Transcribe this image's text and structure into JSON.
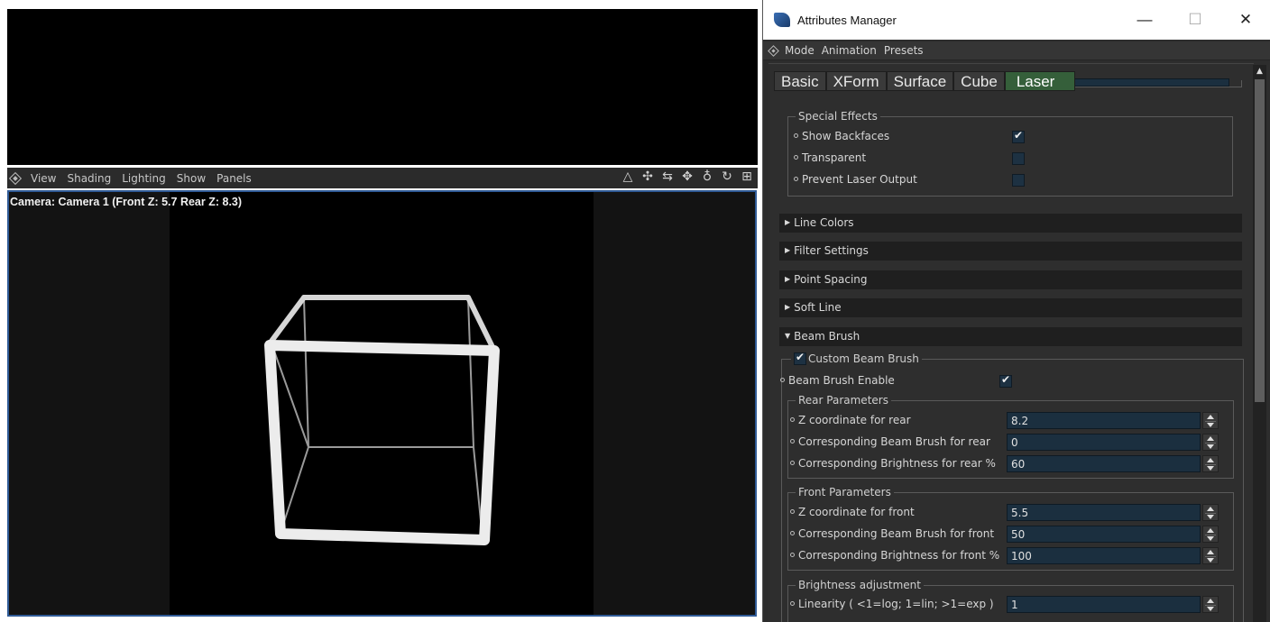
{
  "viewport": {
    "menu": [
      "View",
      "Shading",
      "Lighting",
      "Show",
      "Panels"
    ],
    "camera_label": "Camera: Camera 1 (Front Z: 5.7 Rear Z: 8.3)",
    "tool_icons": [
      "perspective-icon",
      "move-icon",
      "pan-icon",
      "rotate-icon",
      "zoom-icon",
      "orbit-icon",
      "layout-icon"
    ]
  },
  "am": {
    "title": "Attributes Manager",
    "minimize": "—",
    "maximize": "☐",
    "close": "✕",
    "menu": [
      "Mode",
      "Animation",
      "Presets"
    ],
    "tabs": [
      {
        "label": "Basic"
      },
      {
        "label": "XForm"
      },
      {
        "label": "Surface"
      },
      {
        "label": "Cube"
      },
      {
        "label": "Laser",
        "active": true
      }
    ],
    "special_effects": {
      "title": "Special Effects",
      "show_backfaces": {
        "label": "Show Backfaces",
        "checked": true
      },
      "transparent": {
        "label": "Transparent",
        "checked": false
      },
      "prevent_laser": {
        "label": "Prevent Laser Output",
        "checked": false
      }
    },
    "sections": {
      "line_colors": "Line Colors",
      "filter_settings": "Filter Settings",
      "point_spacing": "Point Spacing",
      "soft_line": "Soft Line",
      "beam_brush": "Beam Brush"
    },
    "beam_brush": {
      "custom_label": "Custom Beam Brush",
      "custom_checked": true,
      "enable_label": "Beam Brush Enable",
      "enable_checked": true,
      "rear": {
        "title": "Rear Parameters",
        "z_label": "Z coordinate for rear",
        "z_value": "8.2",
        "brush_label": "Corresponding Beam Brush for rear",
        "brush_value": "0",
        "bright_label": "Corresponding Brightness for rear %",
        "bright_value": "60"
      },
      "front": {
        "title": "Front Parameters",
        "z_label": "Z coordinate for front",
        "z_value": "5.5",
        "brush_label": "Corresponding Beam Brush for front",
        "brush_value": "50",
        "bright_label": "Corresponding Brightness for front %",
        "bright_value": "100"
      },
      "brightness_adj": {
        "title": "Brightness adjustment",
        "linearity_label": "Linearity ( <1=log; 1=lin; >1=exp )",
        "linearity_value": "1"
      }
    }
  }
}
